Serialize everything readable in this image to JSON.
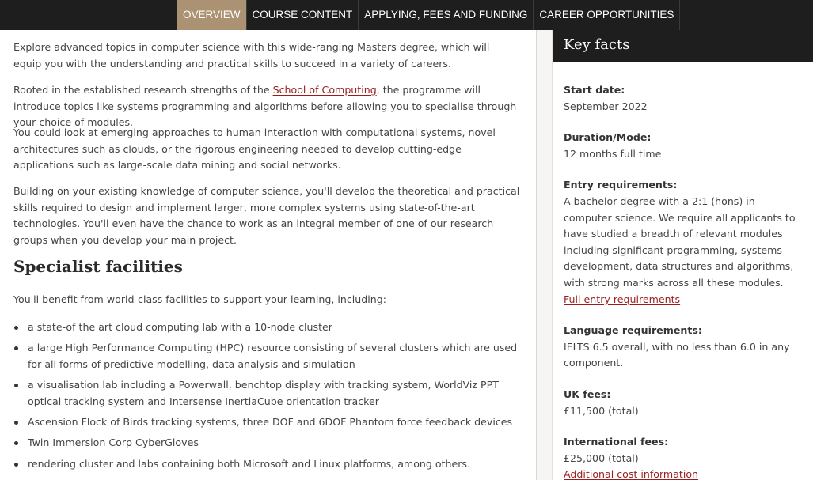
{
  "nav": {
    "items": [
      {
        "label": "OVERVIEW",
        "active": true
      },
      {
        "label": "COURSE CONTENT",
        "active": false
      },
      {
        "label": "APPLYING, FEES AND FUNDING",
        "active": false
      },
      {
        "label": "CAREER OPPORTUNITIES",
        "active": false
      }
    ]
  },
  "main": {
    "p1": "Explore advanced topics in computer science with this wide-ranging Masters degree, which will equip you with the understanding and practical skills to succeed in a variety of careers.",
    "p2_before": "Rooted in the established research strengths of the ",
    "p2_link": "School of Computing",
    "p2_after": ", the programme will introduce topics like systems programming and algorithms before allowing you to specialise through your choice of modules.",
    "p3": "You could look at emerging approaches to human interaction with computational systems, novel architectures such as clouds, or the rigorous engineering needed to develop cutting-edge applications such as large-scale data mining and social networks.",
    "p4": "Building on your existing knowledge of computer science, you'll develop the theoretical and practical skills required to design and implement larger, more complex systems using state-of-the-art technologies. You'll even have the chance to work as an integral member of one of our research groups when you develop your main project.",
    "facilities_heading": "Specialist facilities",
    "facilities_intro": "You'll benefit from world-class facilities to support your learning, including:",
    "facilities": [
      "a state-of the art cloud computing lab with a 10-node cluster",
      "a large High Performance Computing (HPC) resource consisting of several clusters which are used for all forms of predictive modelling, data analysis and simulation",
      "a visualisation lab including a Powerwall, benchtop display with tracking system, WorldViz PPT optical tracking system and Intersense InertiaCube orientation tracker",
      "Ascension Flock of Birds tracking systems, three DOF and 6DOF Phantom force feedback devices",
      "Twin Immersion Corp CyberGloves",
      "rendering cluster and labs containing both Microsoft and Linux platforms, among others."
    ]
  },
  "key_facts": {
    "title": "Key facts",
    "start_label": "Start date:",
    "start_value": "September 2022",
    "duration_label": "Duration/Mode:",
    "duration_value": "12 months full time",
    "entry_label": "Entry requirements:",
    "entry_value": "A bachelor degree with a 2:1 (hons) in computer science. We require all applicants to have studied a breadth of relevant modules including significant programming, systems development, data structures and algorithms, with strong marks across all these modules.",
    "entry_link": "Full entry requirements",
    "language_label": "Language requirements:",
    "language_value": "IELTS 6.5 overall, with no less than 6.0 in any component.",
    "uk_fees_label": "UK fees:",
    "uk_fees_value": "£11,500 (total)",
    "intl_fees_label": "International fees:",
    "intl_fees_value": "£25,000 (total)",
    "cost_link": "Additional cost information"
  },
  "colors": {
    "nav_bg": "#1e1e1e",
    "nav_active": "#ab9272",
    "link": "#9a1c1c"
  }
}
